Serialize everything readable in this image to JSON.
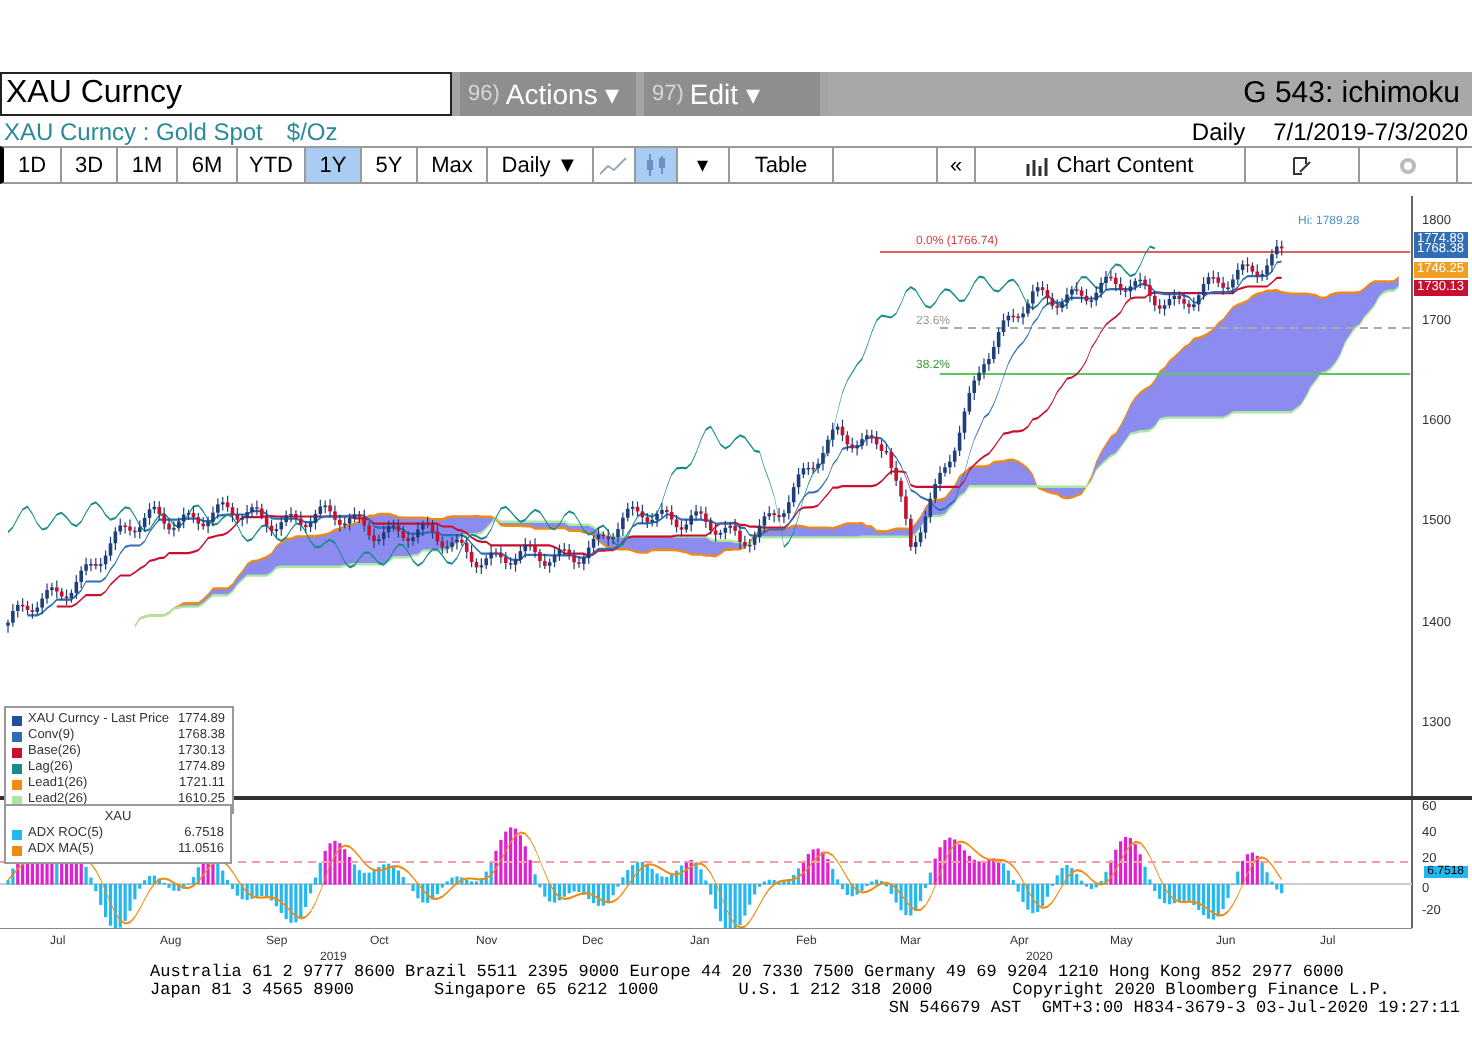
{
  "command_bar": {
    "security": "XAU Curncy",
    "menus": [
      {
        "number": "96)",
        "label": "Actions ▾"
      },
      {
        "number": "97)",
        "label": "Edit ▾"
      }
    ],
    "function": "G 543: ichimoku"
  },
  "header": {
    "security_name": "XAU Curncy : Gold Spot",
    "unit": "$/Oz",
    "frequency": "Daily",
    "date_range": "7/1/2019-7/3/2020"
  },
  "toolbar": {
    "periods": [
      {
        "label": "1D",
        "selected": false
      },
      {
        "label": "3D",
        "selected": false
      },
      {
        "label": "1M",
        "selected": false
      },
      {
        "label": "6M",
        "selected": false
      },
      {
        "label": "YTD",
        "selected": false
      },
      {
        "label": "1Y",
        "selected": true
      },
      {
        "label": "5Y",
        "selected": false
      },
      {
        "label": "Max",
        "selected": false
      }
    ],
    "frequency_dropdown": "Daily ▼",
    "chart_styles": [
      {
        "kind": "line",
        "selected": false
      },
      {
        "kind": "candle",
        "selected": true
      }
    ],
    "style_dropdown": "▾",
    "table_button": "Table",
    "back_button": "«",
    "chart_content_button": "Chart Content"
  },
  "price_chart": {
    "yticks": [
      "1800",
      "1700",
      "1600",
      "1500",
      "1400",
      "1300"
    ],
    "annotations": [
      {
        "kind": "high",
        "text": "Hi: 1789.28"
      },
      {
        "kind": "fib0",
        "text": "0.0% (1766.74)"
      },
      {
        "kind": "fib236",
        "text": "23.6%"
      },
      {
        "kind": "fib382",
        "text": "38.2%"
      }
    ],
    "price_tags": [
      {
        "text": "1774.89",
        "color": "#2f6db5"
      },
      {
        "text": "1768.38",
        "color": "#2f6db5"
      },
      {
        "text": "1746.25",
        "color": "#f0a020"
      },
      {
        "text": "1730.13",
        "color": "#c8102e"
      }
    ],
    "legend": [
      {
        "name": "XAU Curncy - Last Price",
        "value": "1774.89",
        "color": "#1f4e9a"
      },
      {
        "name": "Conv(9)",
        "value": "1768.38",
        "color": "#2f6db5"
      },
      {
        "name": "Base(26)",
        "value": "1730.13",
        "color": "#c8102e"
      },
      {
        "name": "Lag(26)",
        "value": "1774.89",
        "color": "#1a8a8a"
      },
      {
        "name": "Lead1(26)",
        "value": "1721.11",
        "color": "#f08a10"
      },
      {
        "name": "Lead2(26)",
        "value": "1610.25",
        "color": "#a8e8a0"
      }
    ]
  },
  "indicator_chart": {
    "title": "XAU",
    "yticks": [
      "60",
      "40",
      "20",
      "0",
      "-20"
    ],
    "value_tag": "6.7518",
    "legend": [
      {
        "name": "ADX ROC(5)",
        "value": "6.7518",
        "color": "#22b8f0"
      },
      {
        "name": "ADX MA(5)",
        "value": "11.0516",
        "color": "#f08a10"
      }
    ]
  },
  "x_axis": {
    "months": [
      "Jul",
      "Aug",
      "Sep",
      "Oct",
      "Nov",
      "Dec",
      "Jan",
      "Feb",
      "Mar",
      "Apr",
      "May",
      "Jun",
      "Jul"
    ],
    "years": [
      "2019",
      "2020"
    ]
  },
  "footer": {
    "line_1": "Australia 61 2 9777 8600 Brazil 5511 2395 9000 Europe 44 20 7330 7500 Germany 49 69 9204 1210 Hong Kong 852 2977 6000",
    "line_2": [
      "Japan 81 3 4565 8900",
      "Singapore 65 6212 1000",
      "U.S. 1 212 318 2000",
      "Copyright 2020 Bloomberg Finance L.P."
    ],
    "line_3": "SN 546679 AST  GMT+3:00 H834-3679-3 03-Jul-2020 19:27:11"
  }
}
